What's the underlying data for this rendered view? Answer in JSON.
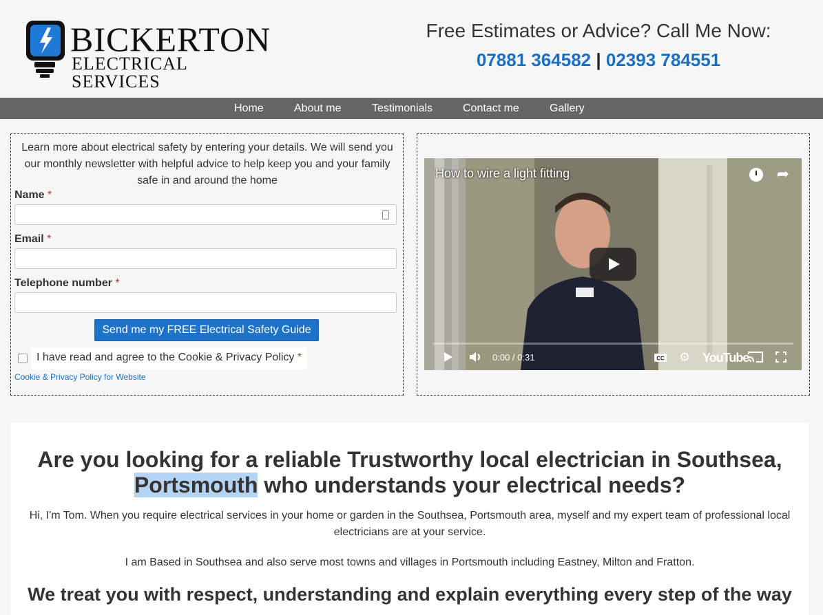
{
  "header": {
    "logo": {
      "name": "BICKERTON",
      "tagline": "ELECTRICAL SERVICES"
    },
    "cta_title": "Free Estimates or Advice? Call Me Now:",
    "phone1": "07881 364582",
    "separator": "|",
    "phone2": "02393 784551",
    "accent_color": "#1a6fc4"
  },
  "nav": {
    "items": [
      {
        "label": "Home"
      },
      {
        "label": "About me"
      },
      {
        "label": "Testimonials"
      },
      {
        "label": "Contact me"
      },
      {
        "label": "Gallery"
      }
    ],
    "bg_color": "#666666"
  },
  "form": {
    "intro": "Learn more about electrical safety by entering your details. We will send you our monthly newsletter with helpful advice to help keep you and your family safe in and around the home",
    "name_label": "Name",
    "email_label": "Email",
    "phone_label": "Telephone number",
    "required_mark": "*",
    "name_value": "",
    "email_value": "",
    "phone_value": "",
    "submit_label": "Send me my FREE Electrical Safety Guide",
    "consent_label": "I have read and agree to the Cookie & Privacy Policy",
    "consent_checked": false,
    "policy_link": "Cookie & Privacy Policy for Website"
  },
  "video": {
    "title": "How to wire a light fitting",
    "time": "0:00 / 0:31",
    "brand": "YouTube",
    "icons": [
      "watch-later-icon",
      "share-icon",
      "play-icon",
      "volume-icon",
      "captions-icon",
      "settings-icon",
      "cast-icon",
      "fullscreen-icon"
    ]
  },
  "main": {
    "heading_before": "Are you looking for a reliable Trustworthy local electrician in Southsea,",
    "heading_highlight": "Portsmouth",
    "heading_after": "who understands your electrical needs?",
    "para1": "Hi, I'm Tom. When you require electrical services in your home or garden in the Southsea, Portsmouth area, myself and my expert team of professional local electricians are at your service.",
    "para2": "I am Based in Southsea and also serve most towns and villages in Portsmouth including Eastney, Milton and Fratton.",
    "heading2": "We treat you with respect, understanding and explain everything every step of the way"
  }
}
